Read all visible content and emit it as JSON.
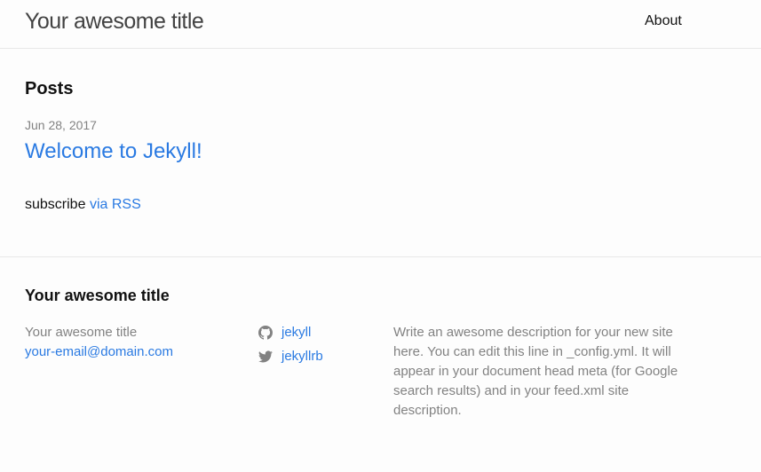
{
  "header": {
    "site_title": "Your awesome title",
    "nav": [
      {
        "label": "About"
      }
    ]
  },
  "main": {
    "heading": "Posts",
    "posts": [
      {
        "date": "Jun 28, 2017",
        "title": "Welcome to Jekyll!"
      }
    ],
    "rss_prefix": "subscribe",
    "rss_link": "via RSS"
  },
  "footer": {
    "heading": "Your awesome title",
    "author_name": "Your awesome title",
    "email": "your-email@domain.com",
    "social": [
      {
        "icon": "github-icon",
        "username": "jekyll"
      },
      {
        "icon": "twitter-icon",
        "username": "jekyllrb"
      }
    ],
    "description": "Write an awesome description for your new site here. You can edit this line in _config.yml. It will appear in your document head meta (for Google search results) and in your feed.xml site description."
  },
  "colors": {
    "link": "#2a7ae2",
    "text": "#111111",
    "muted": "#828282",
    "border": "#e8e8e8",
    "background": "#fdfdfd"
  }
}
